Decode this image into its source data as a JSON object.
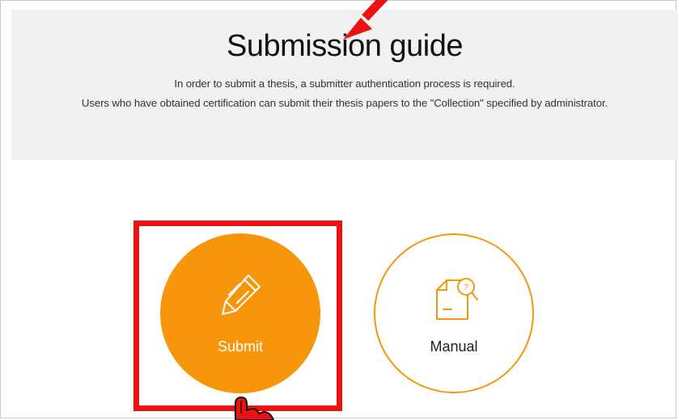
{
  "guide": {
    "title": "Submission guide",
    "description_line1": "In order to submit a thesis, a submitter authentication process is required.",
    "description_line2": "Users who have obtained certification can submit their thesis papers to the \"Collection\" specified by administrator."
  },
  "actions": {
    "submit": {
      "label": "Submit",
      "icon": "pencil-icon"
    },
    "manual": {
      "label": "Manual",
      "icon": "document-search-icon"
    }
  },
  "annotations": {
    "arrow_icon": "arrow-icon",
    "cursor_icon": "hand-pointer-icon"
  },
  "colors": {
    "accent": "#f7960a",
    "highlight": "#ee1111",
    "header_bg": "#f1f1f1"
  }
}
